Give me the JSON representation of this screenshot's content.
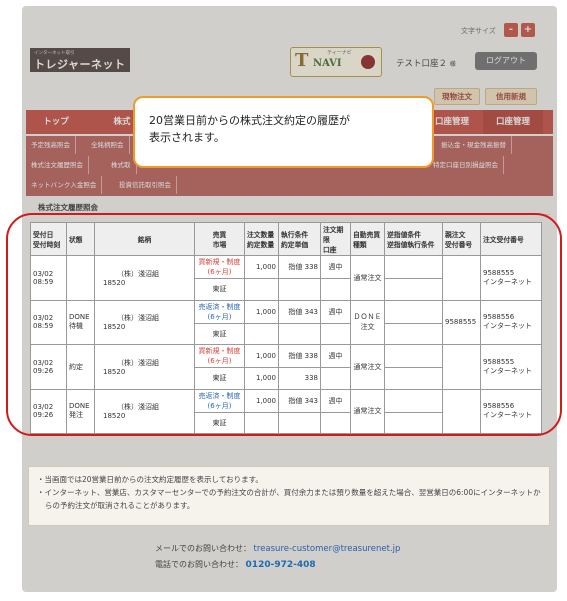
{
  "header": {
    "font_size_label": "文字サイズ",
    "font_minus": "-",
    "font_plus": "+",
    "logo_sub": "インターネット取引",
    "logo_main": "トレジャーネット",
    "tnavi_ruby": "ティーナビ",
    "tnavi_t": "T",
    "tnavi_navi": "NAVI",
    "account_name": "テスト口座２",
    "account_suffix": "様",
    "logout_label": "ログアウト"
  },
  "quick_buttons": [
    "現物注文",
    "信用新規"
  ],
  "nav": {
    "items": [
      "トップ",
      "株式",
      "口座管理",
      "口座管理"
    ]
  },
  "subnav": {
    "row1": [
      "予定残高照会",
      "全銘柄照会",
      "振込金・現金残高振替"
    ],
    "row2": [
      "株式注文履歴照会",
      "株式取",
      "特定口座日別損益照会"
    ],
    "row3": [
      "ネットバンク入金照会",
      "投資信託取引照会"
    ]
  },
  "callout": {
    "line1": "20営業日前からの株式注文約定の履歴が",
    "line2": "表示されます。"
  },
  "section_title": "株式注文履歴照会",
  "table": {
    "headers": {
      "h1a": "受付日",
      "h1b": "受付時刻",
      "h2": "状態",
      "h3": "銘柄",
      "h4a": "売買",
      "h4b": "市場",
      "h5a": "注文数量",
      "h5b": "約定数量",
      "h6a": "執行条件",
      "h6b": "約定単価",
      "h7a": "注文期限",
      "h7b": "口座",
      "h8a": "自動売買",
      "h8b": "種類",
      "h9a": "逆指値条件",
      "h9b": "逆指値執行条件",
      "h10a": "親注文",
      "h10b": "受付番号",
      "h11": "注文受付番号"
    },
    "rows": [
      {
        "date": "03/02",
        "time": "08:59",
        "status1": "",
        "status2": "",
        "name": "（株）淺沼組",
        "code": "18520",
        "trade": "買新規・制度(6ヶ月)",
        "trade_color": "red",
        "market": "東証",
        "qty": "1,000",
        "exec_qty": "",
        "cond": "指値 338",
        "price": "",
        "term": "週中",
        "account": "",
        "auto": "通常注文",
        "auto2": "",
        "stop": "",
        "stop2": "",
        "parent": "",
        "recv": "9588555",
        "channel": "インターネット"
      },
      {
        "date": "03/02",
        "time": "08:59",
        "status1": "DONE",
        "status2": "待機",
        "name": "（株）淺沼組",
        "code": "18520",
        "trade": "売返済・制度(6ヶ月)",
        "trade_color": "blue",
        "market": "東証",
        "qty": "1,000",
        "exec_qty": "",
        "cond": "指値 343",
        "price": "",
        "term": "週中",
        "account": "",
        "auto": "ＤＯＮＥ",
        "auto2": "注文",
        "stop": "",
        "stop2": "",
        "parent": "9588555",
        "recv": "9588556",
        "channel": "インターネット"
      },
      {
        "date": "03/02",
        "time": "09:26",
        "status1": "約定",
        "status2": "",
        "name": "（株）淺沼組",
        "code": "18520",
        "trade": "買新規・制度(6ヶ月)",
        "trade_color": "red",
        "market": "東証",
        "qty": "1,000",
        "exec_qty": "1,000",
        "cond": "指値 338",
        "price": "338",
        "term": "週中",
        "account": "",
        "auto": "通常注文",
        "auto2": "",
        "stop": "",
        "stop2": "",
        "parent": "",
        "recv": "9588555",
        "channel": "インターネット"
      },
      {
        "date": "03/02",
        "time": "09:26",
        "status1": "DONE",
        "status2": "発注",
        "name": "（株）淺沼組",
        "code": "18520",
        "trade": "売返済・制度(6ヶ月)",
        "trade_color": "blue",
        "market": "東証",
        "qty": "1,000",
        "exec_qty": "",
        "cond": "指値 343",
        "price": "",
        "term": "週中",
        "account": "",
        "auto": "通常注文",
        "auto2": "",
        "stop": "",
        "stop2": "",
        "parent": "",
        "recv": "9588556",
        "channel": "インターネット"
      }
    ]
  },
  "notes": {
    "n1": "・当画面では20営業日前からの注文約定履歴を表示しております。",
    "n2": "・インターネット、営業店、カスタマーセンターでの予約注文の合計が、買付余力または預り数量を超えた場合、翌営業日の6:00にインターネットからの予約注文が取消されることがあります。"
  },
  "contact": {
    "mail_label": "メールでのお問い合わせ：",
    "mail": "treasure-customer@treasurenet.jp",
    "tel_label": "電話でのお問い合わせ：",
    "tel": "0120-972-408"
  },
  "colors": {
    "nav_red": "#c4473b",
    "callout_border": "#f09a2a",
    "ring_red": "#d11a1a",
    "buy_red": "#d9403a",
    "sell_blue": "#2a67b6"
  }
}
